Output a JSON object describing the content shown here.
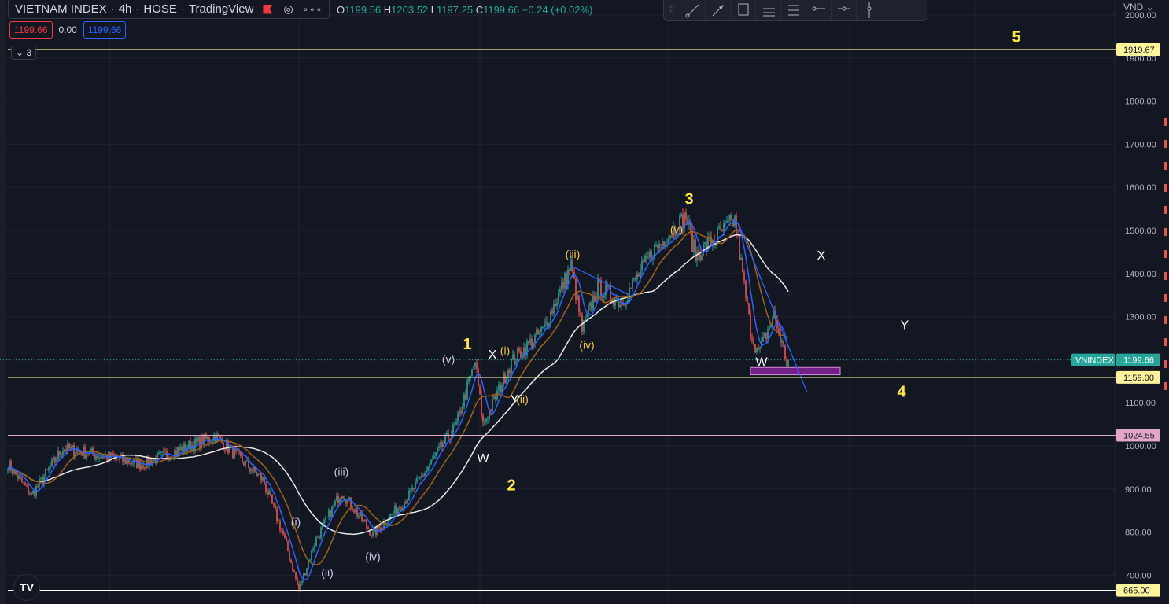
{
  "header": {
    "symbol": "VIETNAM INDEX",
    "interval": "4h",
    "exchange": "HOSE",
    "source": "TradingView",
    "eye_icon": "eye-icon",
    "more_icon": "more-icon",
    "ohlc": {
      "o_label": "O",
      "o": "1199.56",
      "h_label": "H",
      "h": "1203.52",
      "l_label": "L",
      "l": "1197.25",
      "c_label": "C",
      "c": "1199.66",
      "change": "+0.24 (+0.02%)"
    },
    "sell_price": "1199.66",
    "spread": "0.00",
    "buy_price": "1199.66",
    "collapse_label": "3"
  },
  "toolbar": {
    "tools": [
      "trend-line",
      "arrow",
      "rectangle",
      "fib-retracement",
      "parallel-channel",
      "horizontal-ray",
      "horizontal-line",
      "vertical-line"
    ]
  },
  "axis": {
    "currency": "VND"
  },
  "colors": {
    "bg": "#131722",
    "up": "#26a69a",
    "down": "#ef5350",
    "ma_fast": "#2962ff",
    "ma_mid": "#a0621a",
    "ma_slow": "#e8e8e8",
    "wave_yellow": "#ffeb3b",
    "wave_lavender": "#d1c4e9"
  },
  "chart_data": {
    "type": "candlestick",
    "title": "VIETNAM INDEX · 4h · HOSE",
    "ylim": [
      640,
      2010
    ],
    "yticks": [
      700,
      800,
      900,
      1000,
      1100,
      1200,
      1300,
      1400,
      1500,
      1600,
      1700,
      1800,
      1900,
      2000
    ],
    "ylabel": "VND",
    "last_price": {
      "label": "VNINDEX",
      "value": "1199.66"
    },
    "path_keypoints": [
      [
        0,
        958
      ],
      [
        15,
        885
      ],
      [
        35,
        995
      ],
      [
        85,
        958
      ],
      [
        132,
        1022
      ],
      [
        162,
        922
      ],
      [
        175,
        794
      ],
      [
        185,
        666
      ],
      [
        195,
        776
      ],
      [
        212,
        894
      ],
      [
        232,
        794
      ],
      [
        255,
        885
      ],
      [
        285,
        1049
      ],
      [
        297,
        1195
      ],
      [
        302,
        1049
      ],
      [
        320,
        1195
      ],
      [
        340,
        1268
      ],
      [
        358,
        1418
      ],
      [
        365,
        1268
      ],
      [
        375,
        1369
      ],
      [
        390,
        1332
      ],
      [
        410,
        1451
      ],
      [
        431,
        1533
      ],
      [
        437,
        1442
      ],
      [
        462,
        1524
      ],
      [
        472,
        1268
      ],
      [
        477,
        1213
      ],
      [
        487,
        1305
      ],
      [
        495,
        1195
      ],
      [
        496,
        1199.66
      ]
    ],
    "moving_averages": [
      {
        "name": "MA fast",
        "period": 8
      },
      {
        "name": "MA mid",
        "period": 20
      },
      {
        "name": "MA slow",
        "period": 50
      }
    ],
    "horizontal_lines": [
      {
        "value": "1919.67",
        "color": "#fff59d",
        "label_bg": "#fff59d"
      },
      {
        "value": "1159.00",
        "color": "#fff59d",
        "label_bg": "#fff59d"
      },
      {
        "value": "1024.55",
        "color": "#e1a6c8",
        "label_bg": "#e1a6c8"
      },
      {
        "value": "665.00",
        "color": "#ffffff",
        "label_bg": "#fff59d"
      }
    ],
    "trend_lines": [
      {
        "from": [
          358,
          1418
        ],
        "to": [
          395,
          1350
        ]
      },
      {
        "from": [
          465,
          1510
        ],
        "to": [
          508,
          1124
        ]
      }
    ],
    "zones": [
      {
        "from": [
          472,
          1182
        ],
        "to": [
          529,
          1165
        ],
        "color": "#9c27b0"
      }
    ],
    "annotations": [
      {
        "text": "5",
        "i": 641,
        "p": 1949,
        "style": "major"
      },
      {
        "text": "3",
        "i": 433,
        "p": 1573,
        "style": "major"
      },
      {
        "text": "1",
        "i": 292,
        "p": 1237,
        "style": "major"
      },
      {
        "text": "2",
        "i": 320,
        "p": 909,
        "style": "major"
      },
      {
        "text": "4",
        "i": 568,
        "p": 1126,
        "style": "major"
      },
      {
        "text": "X",
        "i": 517,
        "p": 1442,
        "style": "white"
      },
      {
        "text": "Y",
        "i": 570,
        "p": 1281,
        "style": "white"
      },
      {
        "text": "W",
        "i": 479,
        "p": 1195,
        "style": "white"
      },
      {
        "text": "W",
        "i": 302,
        "p": 971,
        "style": "white"
      },
      {
        "text": "X",
        "i": 308,
        "p": 1212,
        "style": "white"
      },
      {
        "text": "Y",
        "i": 322,
        "p": 1108,
        "style": "white"
      },
      {
        "text": "(i)",
        "i": 316,
        "p": 1221,
        "style": "minor"
      },
      {
        "text": "(ii)",
        "i": 327,
        "p": 1108,
        "style": "minor"
      },
      {
        "text": "(iii)",
        "i": 359,
        "p": 1445,
        "style": "minor"
      },
      {
        "text": "(iv)",
        "i": 368,
        "p": 1234,
        "style": "minor"
      },
      {
        "text": "(v)",
        "i": 425,
        "p": 1502,
        "style": "minor"
      },
      {
        "text": "(v)",
        "i": 280,
        "p": 1201,
        "style": "lav"
      },
      {
        "text": "(i)",
        "i": 183,
        "p": 823,
        "style": "lav"
      },
      {
        "text": "(ii)",
        "i": 203,
        "p": 706,
        "style": "lav"
      },
      {
        "text": "(iii)",
        "i": 212,
        "p": 940,
        "style": "lav"
      },
      {
        "text": "(iv)",
        "i": 232,
        "p": 743,
        "style": "lav"
      }
    ]
  }
}
